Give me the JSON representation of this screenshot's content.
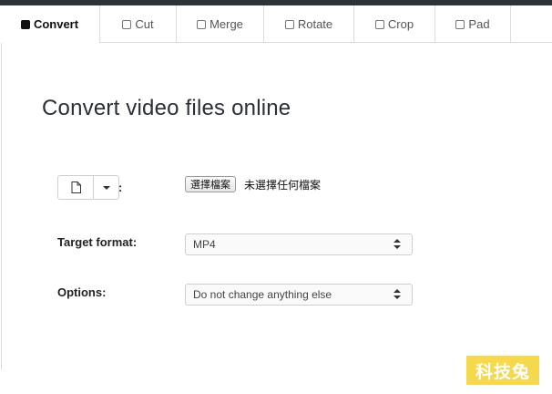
{
  "tabs": [
    {
      "label": "Convert",
      "active": true
    },
    {
      "label": "Cut",
      "active": false
    },
    {
      "label": "Merge",
      "active": false
    },
    {
      "label": "Rotate",
      "active": false
    },
    {
      "label": "Crop",
      "active": false
    },
    {
      "label": "Pad",
      "active": false
    }
  ],
  "page": {
    "title": "Convert video files online"
  },
  "file_input": {
    "colon": ":",
    "choose_button_label": "選擇檔案",
    "no_file_text": "未選擇任何檔案",
    "icon": "file-icon"
  },
  "target_format": {
    "label": "Target format:",
    "selected": "MP4"
  },
  "options": {
    "label": "Options:",
    "selected": "Do not change anything else"
  },
  "watermark": {
    "text": "科技兔"
  },
  "colors": {
    "topbar": "#2e3338",
    "active_tab_text": "#111111",
    "watermark_bg": "#f6d84c"
  }
}
